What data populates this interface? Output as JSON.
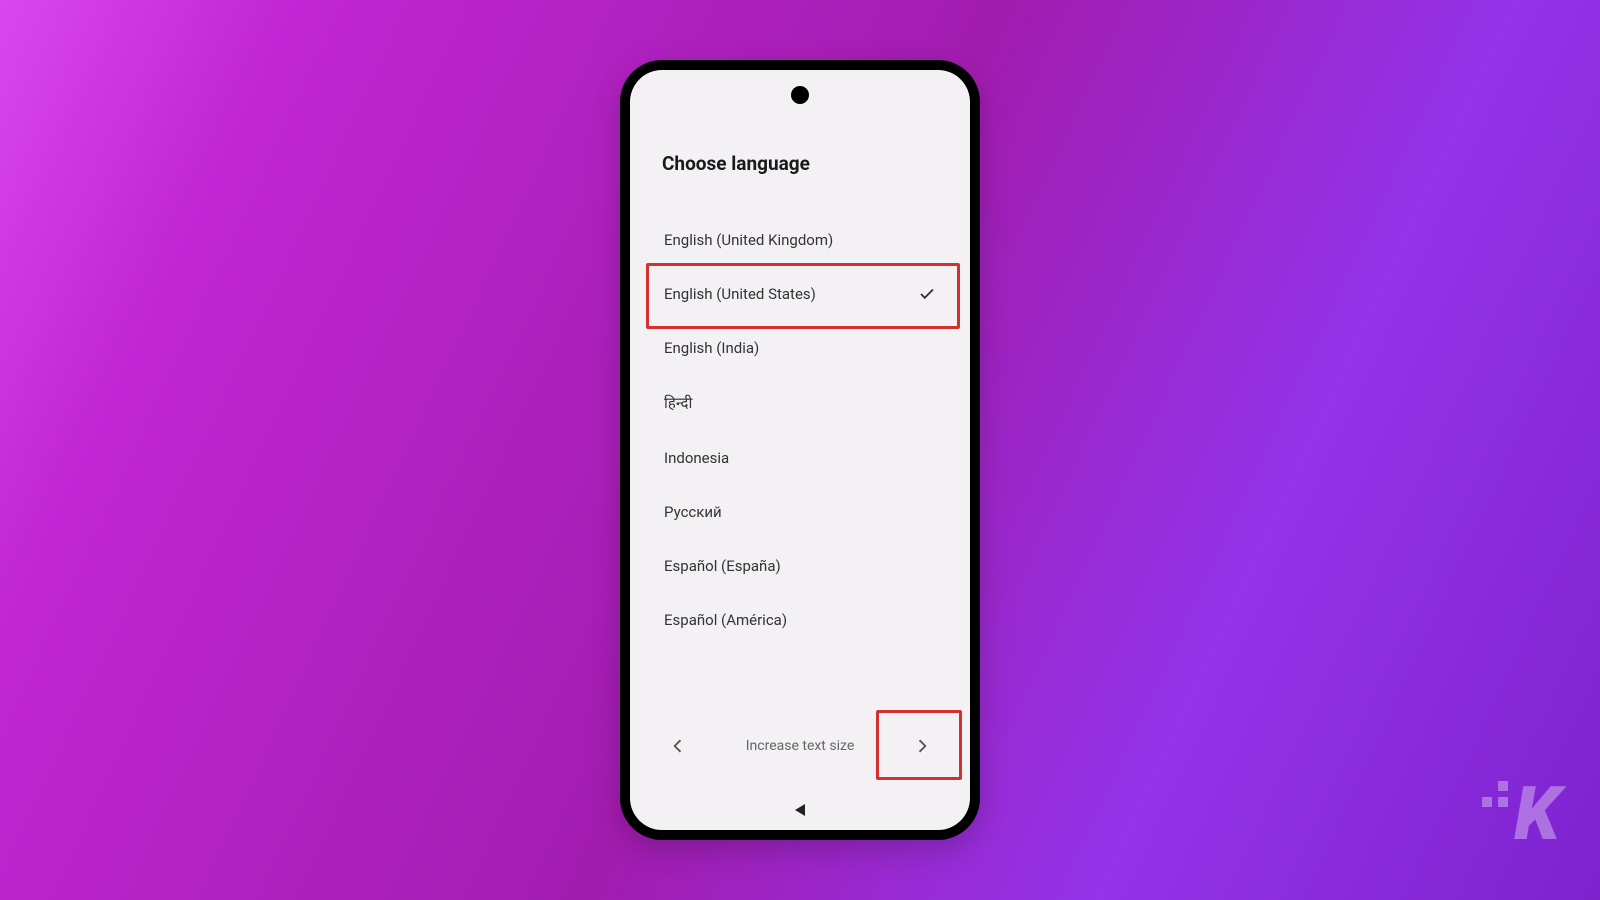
{
  "page": {
    "title": "Choose language"
  },
  "languages": [
    {
      "label": "English (United Kingdom)",
      "selected": false
    },
    {
      "label": "English (United States)",
      "selected": true
    },
    {
      "label": "English (India)",
      "selected": false
    },
    {
      "label": "हिन्दी",
      "selected": false
    },
    {
      "label": "Indonesia",
      "selected": false
    },
    {
      "label": "Русский",
      "selected": false
    },
    {
      "label": "Español (España)",
      "selected": false
    },
    {
      "label": "Español (América)",
      "selected": false
    }
  ],
  "footer": {
    "label": "Increase text size"
  },
  "watermark": {
    "letter": "K"
  }
}
